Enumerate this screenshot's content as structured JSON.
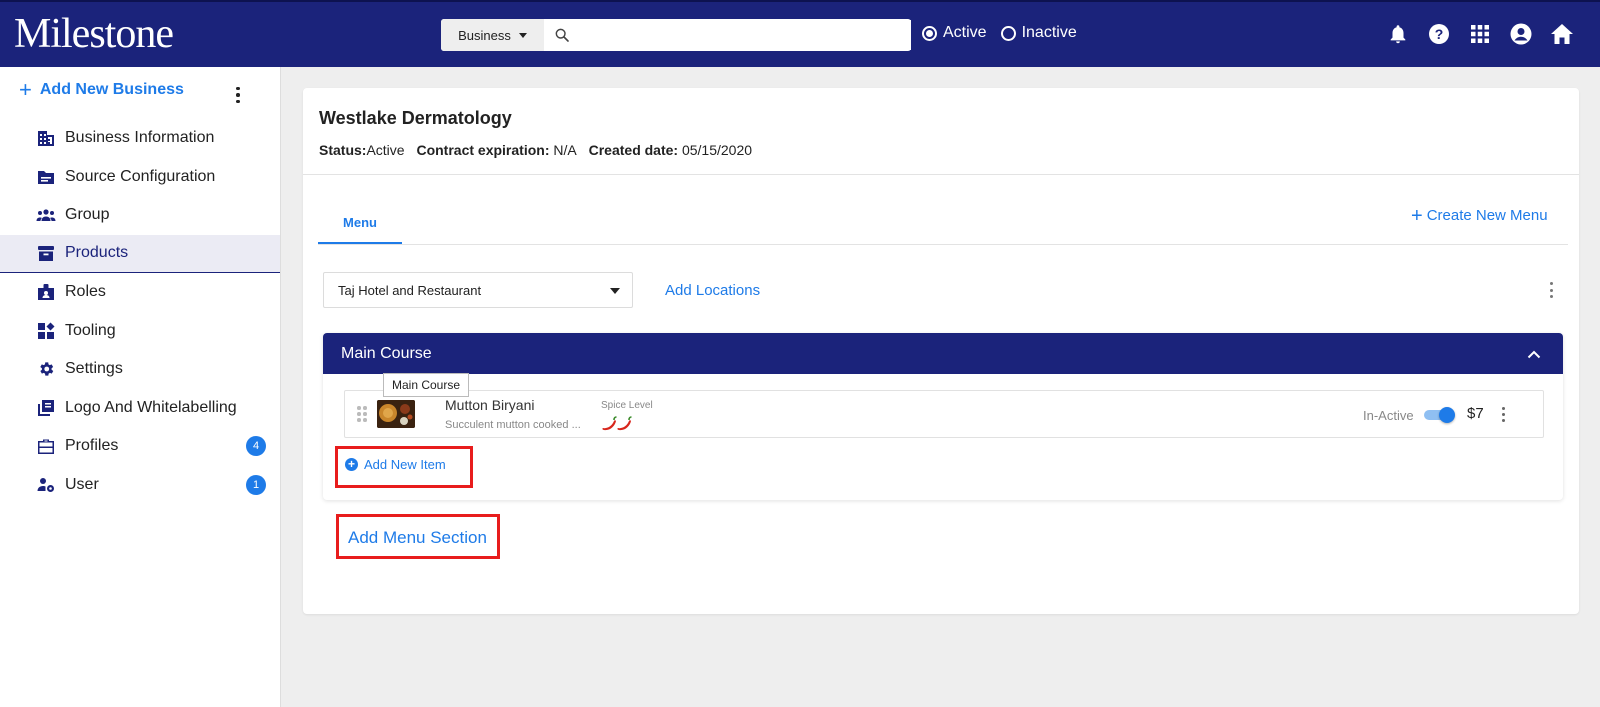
{
  "header": {
    "logo": "Milestone",
    "search_type": "Business",
    "search_placeholder": "",
    "radio_active": "Active",
    "radio_inactive": "Inactive",
    "icons": [
      "bell-icon",
      "help-icon",
      "apps-grid-icon",
      "account-circle-icon",
      "home-icon"
    ]
  },
  "sidebar": {
    "add_label": "Add New Business",
    "items": [
      {
        "label": "Business Information",
        "icon": "building-icon"
      },
      {
        "label": "Source Configuration",
        "icon": "folder-icon"
      },
      {
        "label": "Group",
        "icon": "group-icon"
      },
      {
        "label": "Products",
        "icon": "archive-box-icon",
        "active": true
      },
      {
        "label": "Roles",
        "icon": "badge-id-icon"
      },
      {
        "label": "Tooling",
        "icon": "dashboard-icon"
      },
      {
        "label": "Settings",
        "icon": "gear-icon"
      },
      {
        "label": "Logo And Whitelabelling",
        "icon": "library-icon"
      },
      {
        "label": "Profiles",
        "icon": "briefcase-icon",
        "badge": "4"
      },
      {
        "label": "User",
        "icon": "user-settings-icon",
        "badge": "1"
      }
    ]
  },
  "business": {
    "name": "Westlake Dermatology",
    "status_label": "Status:",
    "status_value": "Active",
    "contract_label": "Contract expiration:",
    "contract_value": "N/A",
    "created_label": "Created date:",
    "created_value": "05/15/2020"
  },
  "tabs": {
    "menu": "Menu",
    "create_menu": "Create New Menu"
  },
  "location": {
    "selected": "Taj Hotel and Restaurant",
    "add_locations": "Add Locations"
  },
  "section": {
    "title": "Main Course",
    "tooltip": "Main Course",
    "items": [
      {
        "name": "Mutton Biryani",
        "description": "Succulent mutton cooked ...",
        "spice_label": "Spice Level",
        "spice_level": 2,
        "status_label": "In-Active",
        "active_toggle": true,
        "price": "$7"
      }
    ],
    "add_item": "Add New Item"
  },
  "add_menu_section": "Add Menu Section",
  "colors": {
    "primary": "#1b237b",
    "accent": "#1e7be8",
    "highlight_box": "#e81c1c"
  }
}
